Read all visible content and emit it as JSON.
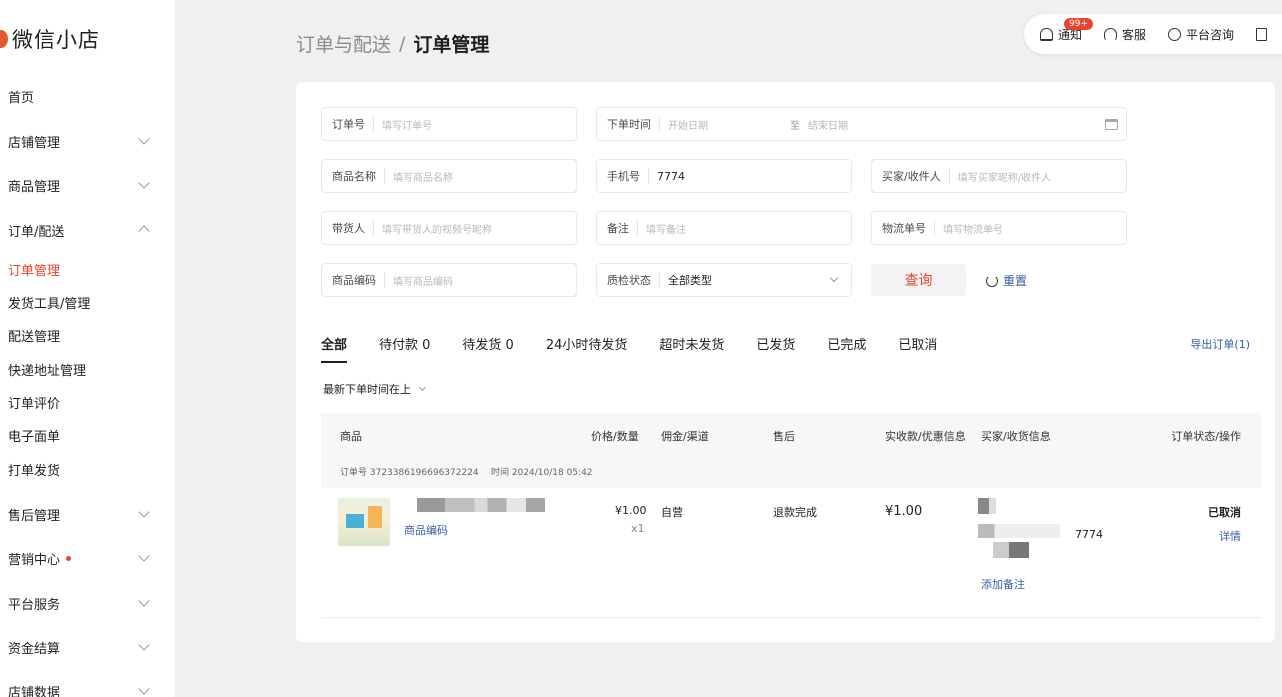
{
  "brand": {
    "name": "微信小店"
  },
  "sidebar": {
    "items": [
      {
        "label": "首页"
      },
      {
        "label": "店铺管理"
      },
      {
        "label": "商品管理"
      },
      {
        "label": "订单/配送"
      },
      {
        "label": "售后管理"
      },
      {
        "label": "营销中心"
      },
      {
        "label": "平台服务"
      },
      {
        "label": "资金结算"
      },
      {
        "label": "店铺数据"
      }
    ],
    "sub_items": [
      {
        "label": "订单管理"
      },
      {
        "label": "发货工具/管理"
      },
      {
        "label": "配送管理"
      },
      {
        "label": "快递地址管理"
      },
      {
        "label": "订单评价"
      },
      {
        "label": "电子面单"
      },
      {
        "label": "打单发货"
      }
    ]
  },
  "breadcrumb": {
    "parent": "订单与配送",
    "sep": "/",
    "current": "订单管理"
  },
  "topbar": {
    "notify": "通知",
    "badge": "99+",
    "service": "客服",
    "consult": "平台咨询"
  },
  "filters": {
    "order_no": {
      "label": "订单号",
      "placeholder": "填写订单号"
    },
    "order_time": {
      "label": "下单时间",
      "start": "开始日期",
      "to": "至",
      "end": "结束日期"
    },
    "product_name": {
      "label": "商品名称",
      "placeholder": "填写商品名称"
    },
    "phone": {
      "label": "手机号",
      "value": "7774"
    },
    "buyer": {
      "label": "买家/收件人",
      "placeholder": "填写买家昵称/收件人"
    },
    "promoter": {
      "label": "带货人",
      "placeholder": "填写带货人的视频号昵称"
    },
    "remark": {
      "label": "备注",
      "placeholder": "填写备注"
    },
    "tracking": {
      "label": "物流单号",
      "placeholder": "填写物流单号"
    },
    "product_code": {
      "label": "商品编码",
      "placeholder": "填写商品编码"
    },
    "qc_status": {
      "label": "质检状态",
      "value": "全部类型"
    },
    "query_btn": "查询",
    "reset_btn": "重置"
  },
  "tabs": [
    {
      "label": "全部"
    },
    {
      "label": "待付款 0"
    },
    {
      "label": "待发货 0"
    },
    {
      "label": "24小时待发货"
    },
    {
      "label": "超时未发货"
    },
    {
      "label": "已发货"
    },
    {
      "label": "已完成"
    },
    {
      "label": "已取消"
    }
  ],
  "export_label": "导出订单(1)",
  "sort_label": "最新下单时间在上",
  "table": {
    "headers": {
      "product": "商品",
      "price_qty": "价格/数量",
      "commission": "佣金/渠道",
      "aftersale": "售后",
      "paid": "实收款/优惠信息",
      "buyer": "买家/收货信息",
      "status": "订单状态/操作"
    },
    "order": {
      "order_no": "订单号 3723386196696372224",
      "time": "时间 2024/10/18 05:42",
      "product_code_link": "商品编码",
      "price": "¥1.00",
      "qty": "x1",
      "channel": "自营",
      "aftersale": "退款完成",
      "paid": "¥1.00",
      "phone_tail": "7774",
      "add_note": "添加备注",
      "status": "已取消",
      "detail": "详情"
    }
  },
  "colors": {
    "accent": "#e8452f",
    "link": "#3a5ba8"
  }
}
